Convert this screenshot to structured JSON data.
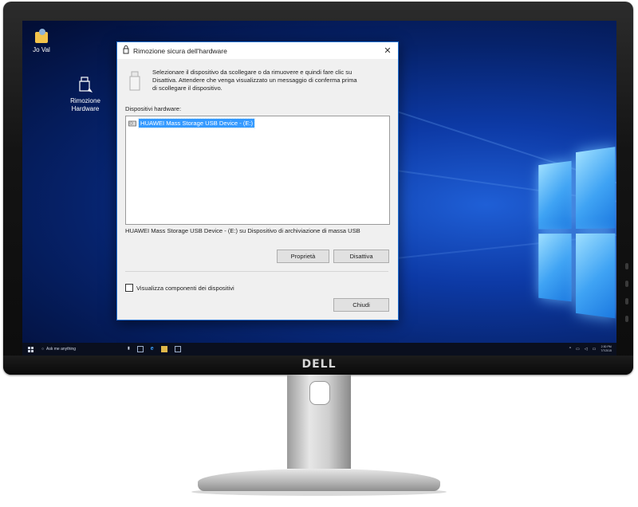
{
  "desktop": {
    "icons": [
      {
        "label": "Jo Val"
      },
      {
        "label_line1": "Rimozione",
        "label_line2": "Hardware"
      }
    ]
  },
  "taskbar": {
    "search_placeholder": "Ask me anything",
    "clock_time": "2:30 PM",
    "clock_date": "7/7/2015"
  },
  "dialog": {
    "title": "Rimozione sicura dell'hardware",
    "close_glyph": "✕",
    "intro_line1": "Selezionare il dispositivo da scollegare o da rimuovere e quindi fare clic su",
    "intro_line2": "Disattiva. Attendere che venga visualizzato un messaggio di conferma prima",
    "intro_line3": "di scollegare il dispositivo.",
    "hardware_label": "Dispositivi hardware:",
    "devices": [
      {
        "name": "HUAWEI Mass Storage USB Device - (E:)",
        "selected": true
      }
    ],
    "device_description": "HUAWEI Mass Storage USB Device - (E:) su Dispositivo di archiviazione di massa USB",
    "properties_button": "Proprietà",
    "disable_button": "Disattiva",
    "show_components_label": "Visualizza componenti dei dispositivi",
    "show_components_checked": false,
    "close_button": "Chiudi"
  },
  "monitor": {
    "brand": "DELL"
  },
  "colors": {
    "dialog_border": "#1e6ed0",
    "selection": "#3399ff",
    "desktop": "#0d3aa6"
  }
}
